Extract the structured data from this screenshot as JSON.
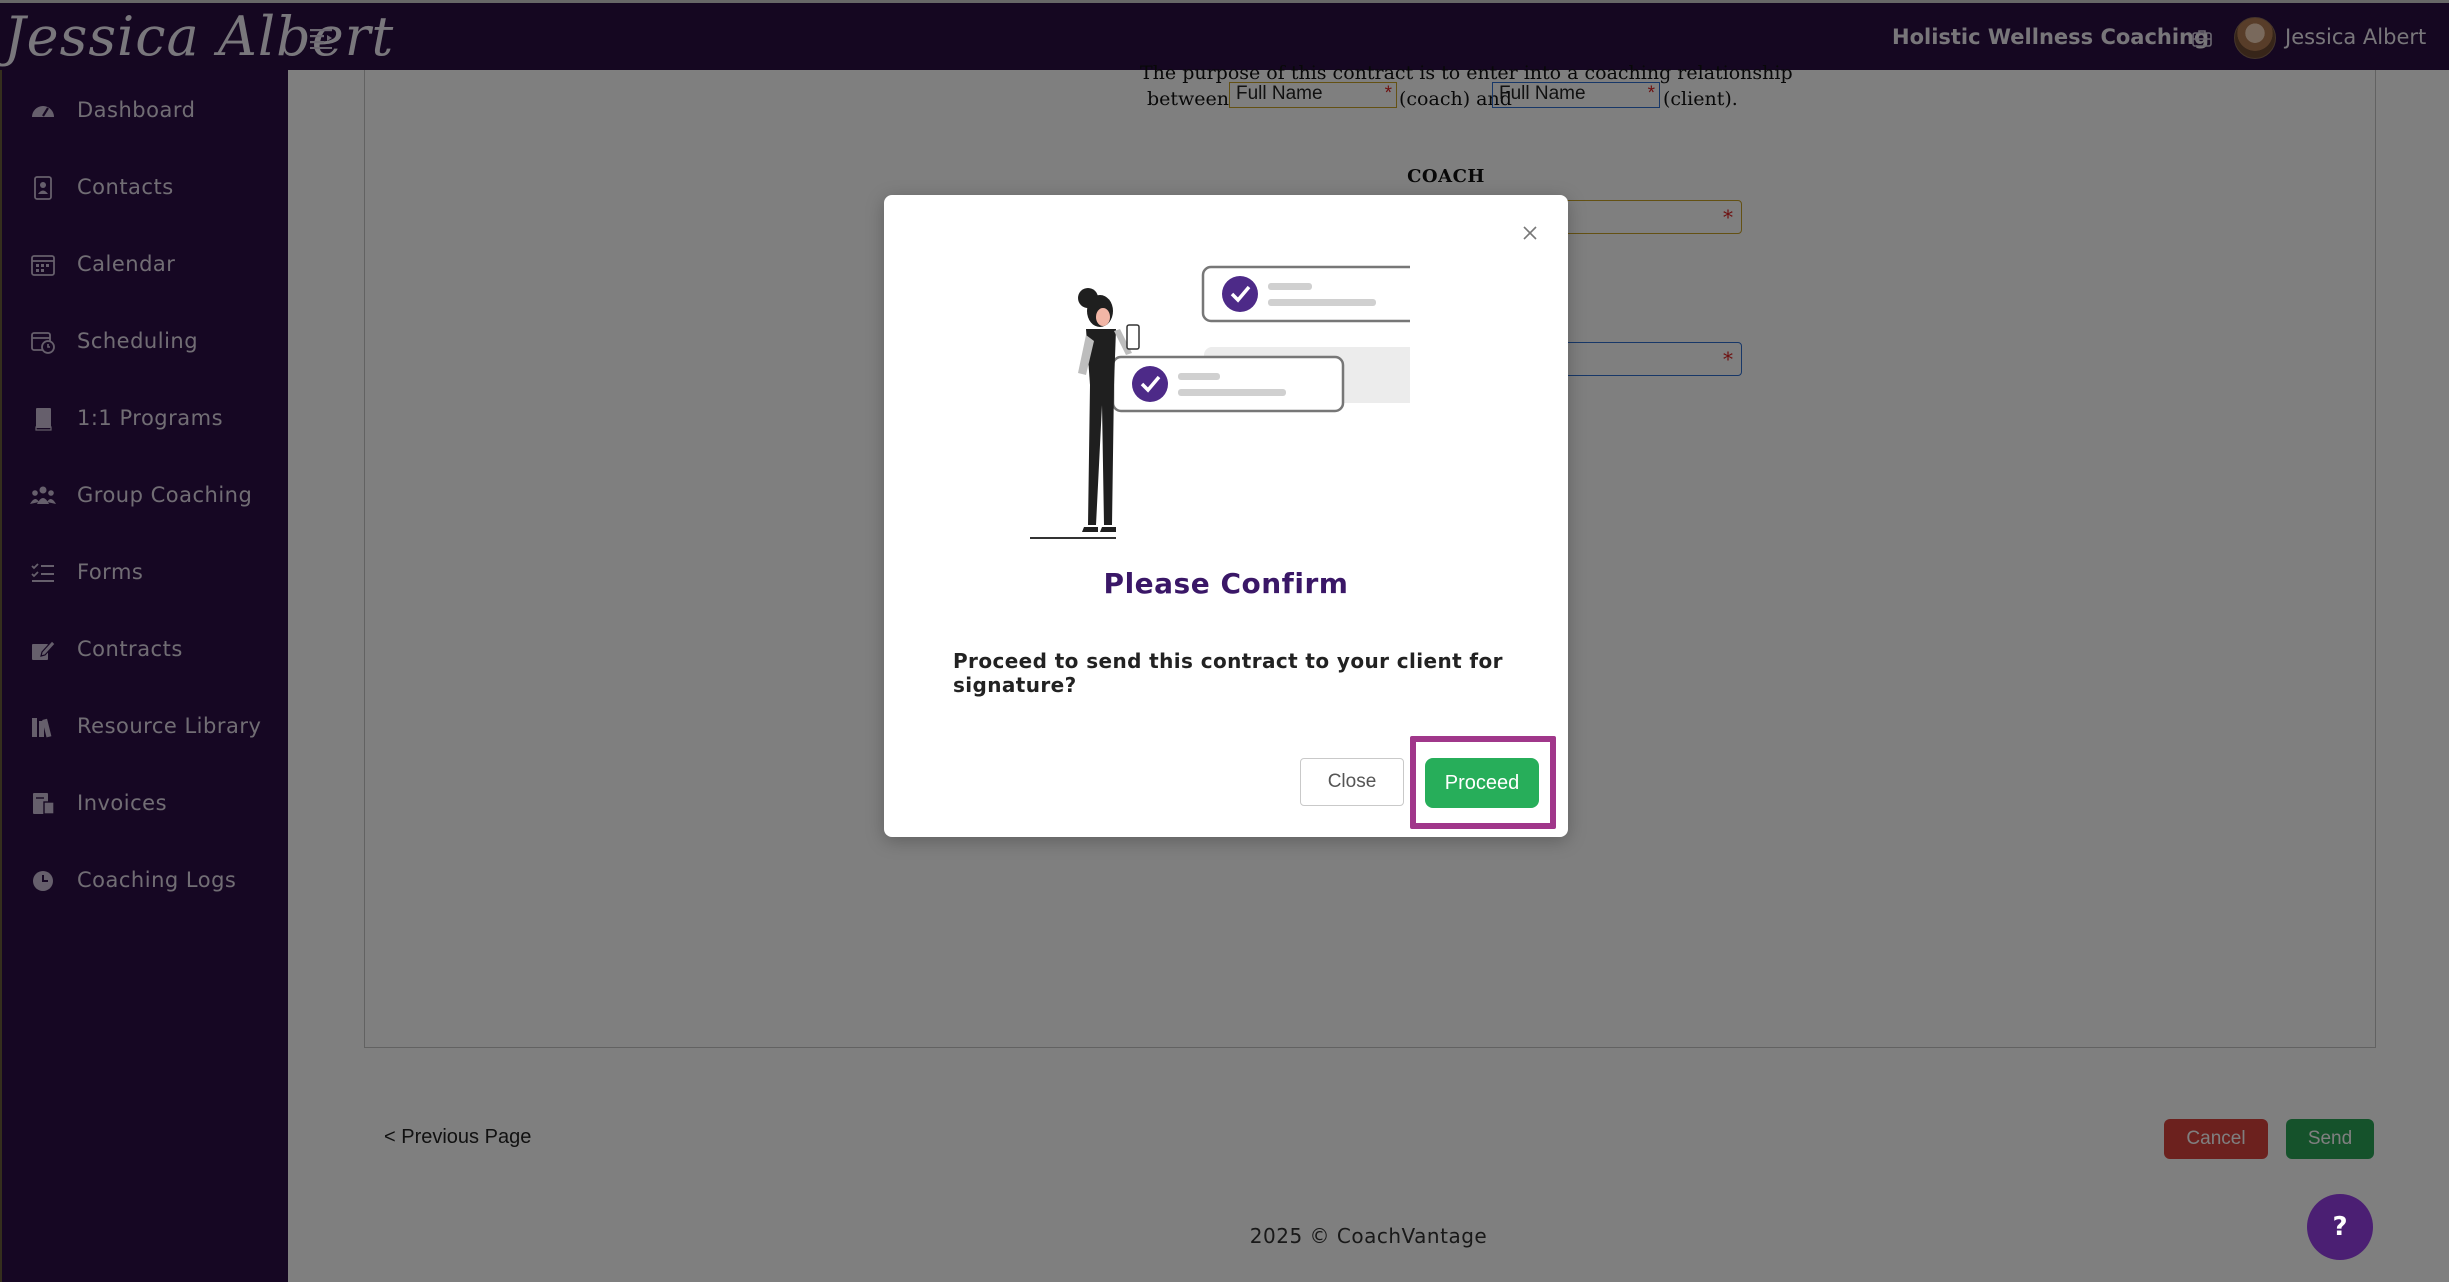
{
  "header": {
    "logo_text": "Jessica Albert",
    "business_name": "Holistic Wellness Coaching",
    "user_name": "Jessica Albert"
  },
  "sidebar": {
    "items": [
      {
        "label": "Dashboard",
        "icon": "dashboard-icon"
      },
      {
        "label": "Contacts",
        "icon": "contacts-icon"
      },
      {
        "label": "Calendar",
        "icon": "calendar-icon"
      },
      {
        "label": "Scheduling",
        "icon": "scheduling-icon"
      },
      {
        "label": "1:1 Programs",
        "icon": "book-icon"
      },
      {
        "label": "Group Coaching",
        "icon": "group-icon"
      },
      {
        "label": "Forms",
        "icon": "checklist-icon"
      },
      {
        "label": "Contracts",
        "icon": "signature-icon"
      },
      {
        "label": "Resource Library",
        "icon": "library-icon"
      },
      {
        "label": "Invoices",
        "icon": "invoice-icon"
      },
      {
        "label": "Coaching Logs",
        "icon": "clock-icon"
      }
    ]
  },
  "document": {
    "line1": "The purpose of this contract is to enter into a coaching relationship",
    "between": "between",
    "coach_suffix": "(coach) and",
    "client_suffix": "(client).",
    "field_placeholder": "Full Name",
    "required_mark": "*",
    "heading": "COACH"
  },
  "footer_nav": {
    "previous_page": "< Previous Page",
    "cancel": "Cancel",
    "send": "Send"
  },
  "footer": {
    "copyright": "2025 © CoachVantage"
  },
  "help": {
    "label": "?"
  },
  "modal": {
    "title": "Please Confirm",
    "body": "Proceed to send this contract to your client for signature?",
    "close_label": "Close",
    "proceed_label": "Proceed"
  },
  "colors": {
    "header_bg": "#2a0f43",
    "sidebar_bg": "#2d0f46",
    "modal_title": "#3a1767",
    "proceed_green": "#27ae5a",
    "cancel_red": "#d9423d",
    "highlight": "#a0378a"
  }
}
